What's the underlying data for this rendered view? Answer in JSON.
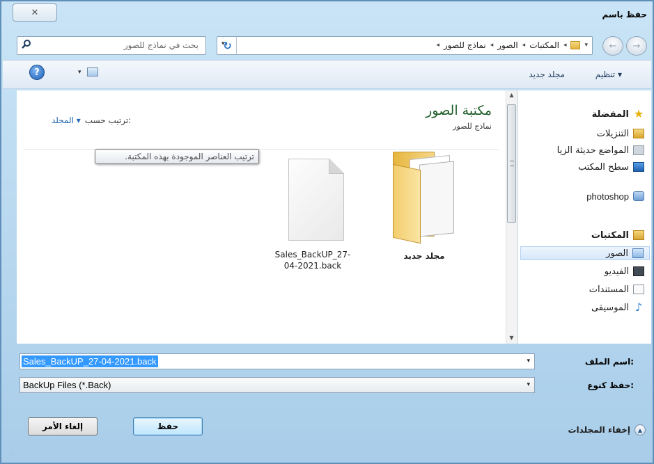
{
  "window": {
    "title": "حفظ باسم",
    "close_glyph": "✕"
  },
  "nav": {
    "back_glyph": "←",
    "forward_glyph": "→"
  },
  "address": {
    "crumbs": [
      "المكتبات",
      "الصور",
      "نماذج للصور"
    ],
    "separator": "◂",
    "dropdown": "▾",
    "refresh_glyph": "↻"
  },
  "search": {
    "placeholder": "بحث في نماذج للصور"
  },
  "toolbar": {
    "organize": "تنظيم ▾",
    "new_folder": "مجلد جديد",
    "help_glyph": "?",
    "view_dropdown": "▾"
  },
  "sidebar": {
    "favorites": "المفضلة",
    "items": [
      {
        "label": "التنزيلات",
        "icon": "downloads-icon"
      },
      {
        "label": "المواضع حديثة الزيا",
        "icon": "recent-places-icon"
      },
      {
        "label": "سطح المكتب",
        "icon": "desktop-icon"
      },
      {
        "label": "photoshop",
        "icon": "photoshop-icon"
      }
    ],
    "libraries": "المكتبات",
    "library_items": [
      {
        "label": "الصور",
        "icon": "pictures-icon"
      },
      {
        "label": "الفيديو",
        "icon": "video-icon"
      },
      {
        "label": "المستندات",
        "icon": "documents-icon"
      },
      {
        "label": "الموسيقى",
        "icon": "music-icon"
      }
    ]
  },
  "library": {
    "title": "مكتبة الصور",
    "subtitle": "نماذج للصور",
    "arrange_label": "ترتيب حسب:",
    "arrange_value": "المجلد ▾"
  },
  "tooltip": "ترتيب العناصر الموجودة بهذه المكتبة.",
  "files": [
    {
      "name": "مجلد جديد",
      "type": "folder"
    },
    {
      "name_line1": "Sales_BackUP_27-",
      "name_line2": "04-2021.back",
      "type": "file"
    }
  ],
  "form": {
    "filename_label": "اسم الملف:",
    "filename_value": "Sales_BackUP_27-04-2021.back",
    "filetype_label": "حفظ كنوع:",
    "filetype_value": "BackUp Files (*.Back)",
    "dropdown": "▾"
  },
  "buttons": {
    "save": "حفظ",
    "cancel": "إلغاء الأمر"
  },
  "hide_folders": "إخفاء المجلدات",
  "colors": {
    "accent": "#3399ff",
    "library_title": "#1f5e2a",
    "link": "#2167b3"
  }
}
